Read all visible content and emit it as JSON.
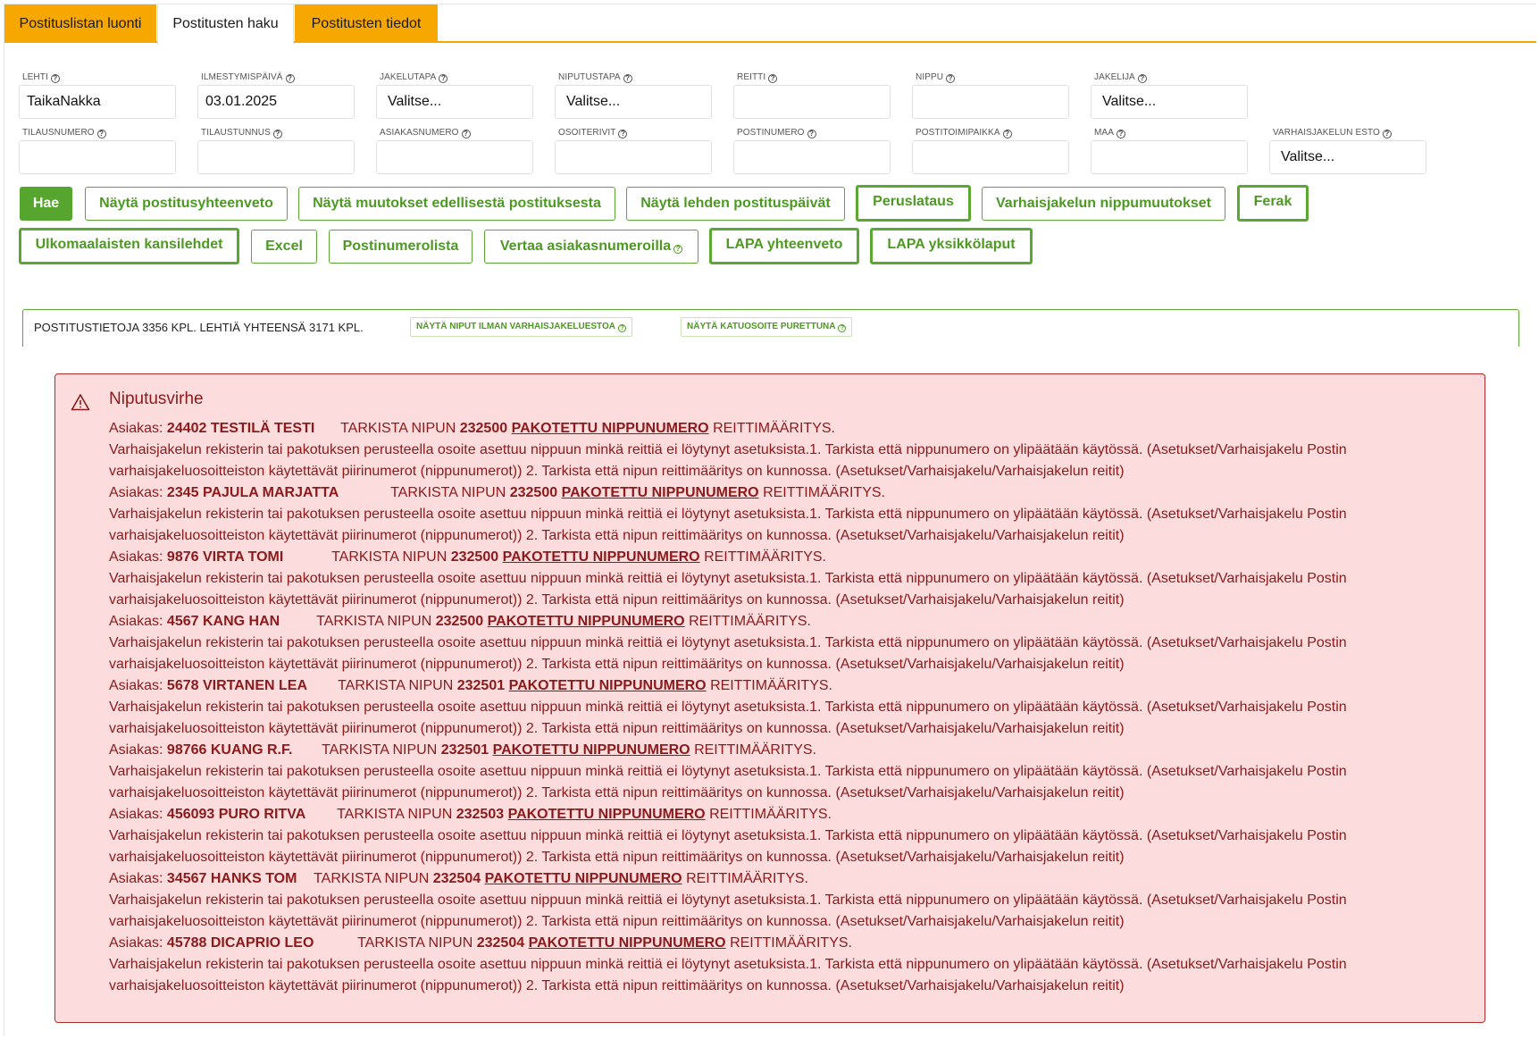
{
  "tabs": [
    {
      "label": "Postituslistan luonti"
    },
    {
      "label": "Postitusten haku"
    },
    {
      "label": "Postitusten tiedot"
    }
  ],
  "fields_row1": [
    {
      "label": "LEHTI",
      "value": "TaikaNakka"
    },
    {
      "label": "ILMESTYMISPÄIVÄ",
      "value": "03.01.2025"
    },
    {
      "label": "JAKELUTAPA",
      "value": "Valitse..."
    },
    {
      "label": "NIPUTUSTAPA",
      "value": "Valitse..."
    },
    {
      "label": "REITTI",
      "value": ""
    },
    {
      "label": "NIPPU",
      "value": ""
    },
    {
      "label": "JAKELIJA",
      "value": "Valitse..."
    }
  ],
  "fields_row2": [
    {
      "label": "TILAUSNUMERO",
      "value": ""
    },
    {
      "label": "TILAUSTUNNUS",
      "value": ""
    },
    {
      "label": "ASIAKASNUMERO",
      "value": ""
    },
    {
      "label": "OSOITERIVIT",
      "value": ""
    },
    {
      "label": "POSTINUMERO",
      "value": ""
    },
    {
      "label": "POSTITOIMIPAIKKA",
      "value": ""
    },
    {
      "label": "MAA",
      "value": ""
    },
    {
      "label": "VARHAISJAKELUN ESTO",
      "value": "Valitse..."
    }
  ],
  "buttons": {
    "hae": "Hae",
    "yhteenveto": "Näytä postitusyhteenveto",
    "muutokset": "Näytä muutokset edellisestä postituksesta",
    "paivat": "Näytä lehden postituspäivät",
    "peruslataus": "Peruslataus",
    "nippumuutokset": "Varhaisjakelun nippumuutokset",
    "ferak": "Ferak",
    "ulkomaalaisten": "Ulkomaalaisten kansilehdet",
    "excel": "Excel",
    "postinumerolista": "Postinumerolista",
    "vertaa": "Vertaa asiakasnumeroilla",
    "lapa_yhteenveto": "LAPA yhteenveto",
    "lapa_yksikko": "LAPA yksikkölaput"
  },
  "summary": {
    "text": "POSTITUSTIETOJA 3356 KPL. LEHTIÄ YHTEENSÄ 3171 KPL.",
    "chip1": "NÄYTÄ NIPUT ILMAN VARHAISJAKELUESTOA",
    "chip2": "NÄYTÄ KATUOSOITE PURETTUNA"
  },
  "error": {
    "title": "Niputusvirhe",
    "customer_prefix": "Asiakas:",
    "check_text": "TARKISTA NIPUN",
    "link_text": "PAKOTETTU NIPPUNUMERO",
    "suffix": "REITTIMÄÄRITYS.",
    "description": "Varhaisjakelun rekisterin tai pakotuksen perusteella osoite asettuu nippuun minkä reittiä ei löytynyt asetuksista.1. Tarkista että nippunumero on ylipäätään käytössä. (Asetukset/Varhaisjakelu Postin varhaisjakeluosoitteiston käytettävät piirinumerot (nippunumerot)) 2. Tarkista että nipun reittimääritys on kunnossa. (Asetukset/Varhaisjakelu/Varhaisjakelun reitit)",
    "entries": [
      {
        "customer": "24402 TESTILÄ TESTI",
        "nippu": "232500"
      },
      {
        "customer": "2345 PAJULA MARJATTA",
        "nippu": "232500"
      },
      {
        "customer": "9876 VIRTA TOMI",
        "nippu": "232500"
      },
      {
        "customer": "4567 KANG HAN",
        "nippu": "232500"
      },
      {
        "customer": "5678 VIRTANEN LEA",
        "nippu": "232501"
      },
      {
        "customer": "98766 KUANG R.F.",
        "nippu": "232501"
      },
      {
        "customer": "456093 PURO RITVA",
        "nippu": "232503"
      },
      {
        "customer": "34567 HANKS TOM",
        "nippu": "232504"
      },
      {
        "customer": "45788 DICAPRIO LEO",
        "nippu": "232504"
      }
    ]
  },
  "colors": {
    "tab_orange": "#f7a800",
    "green": "#5aa832",
    "error_bg": "#fcdcdd",
    "error_text": "#8b1a1a"
  }
}
